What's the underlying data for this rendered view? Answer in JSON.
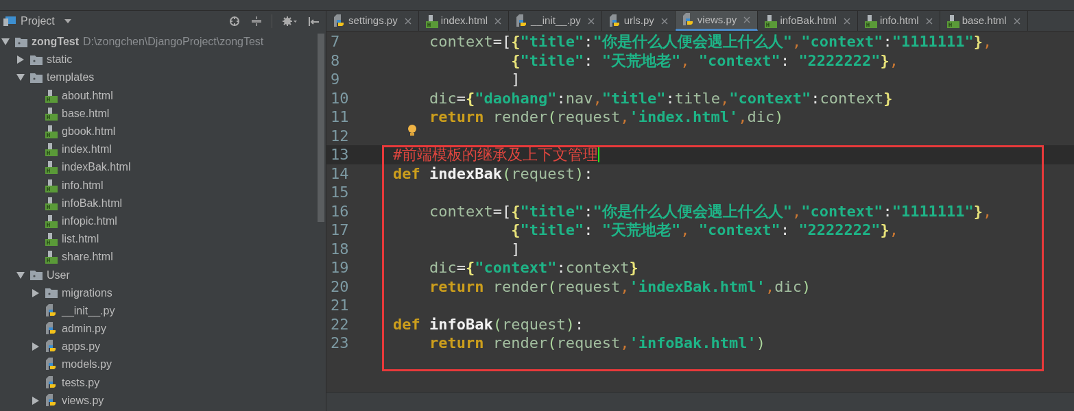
{
  "project_panel": {
    "title": "Project",
    "tree": [
      {
        "name": "zongTest",
        "kind": "root",
        "path": "D:\\zongchen\\DjangoProject\\zongTest",
        "expanded": true,
        "children": [
          {
            "name": "static",
            "kind": "folder",
            "expanded": false
          },
          {
            "name": "templates",
            "kind": "folder",
            "expanded": true,
            "children": [
              {
                "name": "about.html",
                "kind": "html"
              },
              {
                "name": "base.html",
                "kind": "html"
              },
              {
                "name": "gbook.html",
                "kind": "html"
              },
              {
                "name": "index.html",
                "kind": "html"
              },
              {
                "name": "indexBak.html",
                "kind": "html"
              },
              {
                "name": "info.html",
                "kind": "html"
              },
              {
                "name": "infoBak.html",
                "kind": "html"
              },
              {
                "name": "infopic.html",
                "kind": "html"
              },
              {
                "name": "list.html",
                "kind": "html"
              },
              {
                "name": "share.html",
                "kind": "html"
              }
            ]
          },
          {
            "name": "User",
            "kind": "folder",
            "expanded": true,
            "children": [
              {
                "name": "migrations",
                "kind": "folder",
                "expanded": false
              },
              {
                "name": "__init__.py",
                "kind": "py"
              },
              {
                "name": "admin.py",
                "kind": "py"
              },
              {
                "name": "apps.py",
                "kind": "py",
                "expanded": false
              },
              {
                "name": "models.py",
                "kind": "py"
              },
              {
                "name": "tests.py",
                "kind": "py"
              },
              {
                "name": "views.py",
                "kind": "py",
                "expanded": false
              }
            ]
          }
        ]
      }
    ]
  },
  "tabs": [
    {
      "label": "settings.py",
      "kind": "py",
      "selected": false
    },
    {
      "label": "index.html",
      "kind": "html",
      "selected": false
    },
    {
      "label": "__init__.py",
      "kind": "py",
      "selected": false
    },
    {
      "label": "urls.py",
      "kind": "py",
      "selected": false
    },
    {
      "label": "views.py",
      "kind": "py",
      "selected": true
    },
    {
      "label": "infoBak.html",
      "kind": "html",
      "selected": false
    },
    {
      "label": "info.html",
      "kind": "html",
      "selected": false
    },
    {
      "label": "base.html",
      "kind": "html",
      "selected": false
    }
  ],
  "editor": {
    "lines": [
      {
        "number": "7",
        "current": false,
        "hint": false,
        "tokens": [
          {
            "kind": "plain",
            "text": "    context"
          },
          {
            "kind": "op",
            "text": "=["
          },
          {
            "kind": "brace",
            "text": "{"
          },
          {
            "kind": "str",
            "text": "\"title\""
          },
          {
            "kind": "op",
            "text": ":"
          },
          {
            "kind": "str",
            "text": "\"你是什么人便会遇上什么人\""
          },
          {
            "kind": "comma",
            "text": ","
          },
          {
            "kind": "str",
            "text": "\"context\""
          },
          {
            "kind": "op",
            "text": ":"
          },
          {
            "kind": "str",
            "text": "\"1111111\""
          },
          {
            "kind": "brace",
            "text": "}"
          },
          {
            "kind": "comma",
            "text": ","
          }
        ]
      },
      {
        "number": "8",
        "current": false,
        "hint": false,
        "tokens": [
          {
            "kind": "brace",
            "text": "             {"
          },
          {
            "kind": "str",
            "text": "\"title\""
          },
          {
            "kind": "op",
            "text": ": "
          },
          {
            "kind": "str",
            "text": "\"天荒地老\""
          },
          {
            "kind": "comma",
            "text": ", "
          },
          {
            "kind": "str",
            "text": "\"context\""
          },
          {
            "kind": "op",
            "text": ": "
          },
          {
            "kind": "str",
            "text": "\"2222222\""
          },
          {
            "kind": "brace",
            "text": "}"
          },
          {
            "kind": "comma",
            "text": ","
          }
        ]
      },
      {
        "number": "9",
        "current": false,
        "hint": false,
        "tokens": [
          {
            "kind": "op",
            "text": "             ]"
          }
        ]
      },
      {
        "number": "10",
        "current": false,
        "hint": false,
        "tokens": [
          {
            "kind": "plain",
            "text": "    dic"
          },
          {
            "kind": "op",
            "text": "="
          },
          {
            "kind": "brace",
            "text": "{"
          },
          {
            "kind": "str",
            "text": "\"daohang\""
          },
          {
            "kind": "op",
            "text": ":"
          },
          {
            "kind": "plain",
            "text": "nav"
          },
          {
            "kind": "comma",
            "text": ","
          },
          {
            "kind": "str",
            "text": "\"title\""
          },
          {
            "kind": "op",
            "text": ":"
          },
          {
            "kind": "plain",
            "text": "title"
          },
          {
            "kind": "comma",
            "text": ","
          },
          {
            "kind": "str",
            "text": "\"context\""
          },
          {
            "kind": "op",
            "text": ":"
          },
          {
            "kind": "plain",
            "text": "context"
          },
          {
            "kind": "brace",
            "text": "}"
          }
        ]
      },
      {
        "number": "11",
        "current": false,
        "hint": false,
        "tokens": [
          {
            "kind": "kw",
            "text": "    return"
          },
          {
            "kind": "plain",
            "text": " render"
          },
          {
            "kind": "paren",
            "text": "("
          },
          {
            "kind": "plain",
            "text": "request"
          },
          {
            "kind": "comma",
            "text": ","
          },
          {
            "kind": "str",
            "text": "'index.html'"
          },
          {
            "kind": "comma",
            "text": ","
          },
          {
            "kind": "plain",
            "text": "dic"
          },
          {
            "kind": "paren",
            "text": ")"
          }
        ]
      },
      {
        "number": "12",
        "current": false,
        "hint": true
      }
    ],
    "framed_block": {
      "lines": [
        {
          "number": "13",
          "current": true,
          "hint": false,
          "tokens": [
            {
              "kind": "comment",
              "text": "#前端模板的继承及上下文管理"
            }
          ]
        },
        {
          "number": "14",
          "current": false,
          "hint": false,
          "tokens": [
            {
              "kind": "kw",
              "text": "def"
            },
            {
              "kind": "fn",
              "text": " indexBak"
            },
            {
              "kind": "paren",
              "text": "("
            },
            {
              "kind": "plain",
              "text": "request"
            },
            {
              "kind": "paren",
              "text": ")"
            },
            {
              "kind": "op",
              "text": ":"
            }
          ]
        },
        {
          "number": "15",
          "current": false,
          "hint": false
        },
        {
          "number": "16",
          "current": false,
          "hint": false,
          "tokens": [
            {
              "kind": "plain",
              "text": "    context"
            },
            {
              "kind": "op",
              "text": "=["
            },
            {
              "kind": "brace",
              "text": "{"
            },
            {
              "kind": "str",
              "text": "\"title\""
            },
            {
              "kind": "op",
              "text": ":"
            },
            {
              "kind": "str",
              "text": "\"你是什么人便会遇上什么人\""
            },
            {
              "kind": "comma",
              "text": ","
            },
            {
              "kind": "str",
              "text": "\"context\""
            },
            {
              "kind": "op",
              "text": ":"
            },
            {
              "kind": "str",
              "text": "\"1111111\""
            },
            {
              "kind": "brace",
              "text": "}"
            },
            {
              "kind": "comma",
              "text": ","
            }
          ]
        },
        {
          "number": "17",
          "current": false,
          "hint": false,
          "tokens": [
            {
              "kind": "brace",
              "text": "             {"
            },
            {
              "kind": "str",
              "text": "\"title\""
            },
            {
              "kind": "op",
              "text": ": "
            },
            {
              "kind": "str",
              "text": "\"天荒地老\""
            },
            {
              "kind": "comma",
              "text": ", "
            },
            {
              "kind": "str",
              "text": "\"context\""
            },
            {
              "kind": "op",
              "text": ": "
            },
            {
              "kind": "str",
              "text": "\"2222222\""
            },
            {
              "kind": "brace",
              "text": "}"
            },
            {
              "kind": "comma",
              "text": ","
            }
          ]
        },
        {
          "number": "18",
          "current": false,
          "hint": false,
          "tokens": [
            {
              "kind": "op",
              "text": "             ]"
            }
          ]
        },
        {
          "number": "19",
          "current": false,
          "hint": false,
          "tokens": [
            {
              "kind": "plain",
              "text": "    dic"
            },
            {
              "kind": "op",
              "text": "="
            },
            {
              "kind": "brace",
              "text": "{"
            },
            {
              "kind": "str",
              "text": "\"context\""
            },
            {
              "kind": "op",
              "text": ":"
            },
            {
              "kind": "plain",
              "text": "context"
            },
            {
              "kind": "brace",
              "text": "}"
            }
          ]
        },
        {
          "number": "20",
          "current": false,
          "hint": false,
          "tokens": [
            {
              "kind": "kw",
              "text": "    return"
            },
            {
              "kind": "plain",
              "text": " render"
            },
            {
              "kind": "paren",
              "text": "("
            },
            {
              "kind": "plain",
              "text": "request"
            },
            {
              "kind": "comma",
              "text": ","
            },
            {
              "kind": "str",
              "text": "'indexBak.html'"
            },
            {
              "kind": "comma",
              "text": ","
            },
            {
              "kind": "plain",
              "text": "dic"
            },
            {
              "kind": "paren",
              "text": ")"
            }
          ]
        },
        {
          "number": "21",
          "current": false,
          "hint": false
        },
        {
          "number": "22",
          "current": false,
          "hint": false,
          "tokens": [
            {
              "kind": "kw",
              "text": "def"
            },
            {
              "kind": "fn",
              "text": " infoBak"
            },
            {
              "kind": "paren",
              "text": "("
            },
            {
              "kind": "plain",
              "text": "request"
            },
            {
              "kind": "paren",
              "text": ")"
            },
            {
              "kind": "op",
              "text": ":"
            }
          ]
        },
        {
          "number": "23",
          "current": false,
          "hint": false,
          "tokens": [
            {
              "kind": "kw",
              "text": "    return"
            },
            {
              "kind": "plain",
              "text": " render"
            },
            {
              "kind": "paren",
              "text": "("
            },
            {
              "kind": "plain",
              "text": "request"
            },
            {
              "kind": "comma",
              "text": ","
            },
            {
              "kind": "str",
              "text": "'infoBak.html'"
            },
            {
              "kind": "paren",
              "text": ")"
            }
          ]
        }
      ]
    }
  }
}
